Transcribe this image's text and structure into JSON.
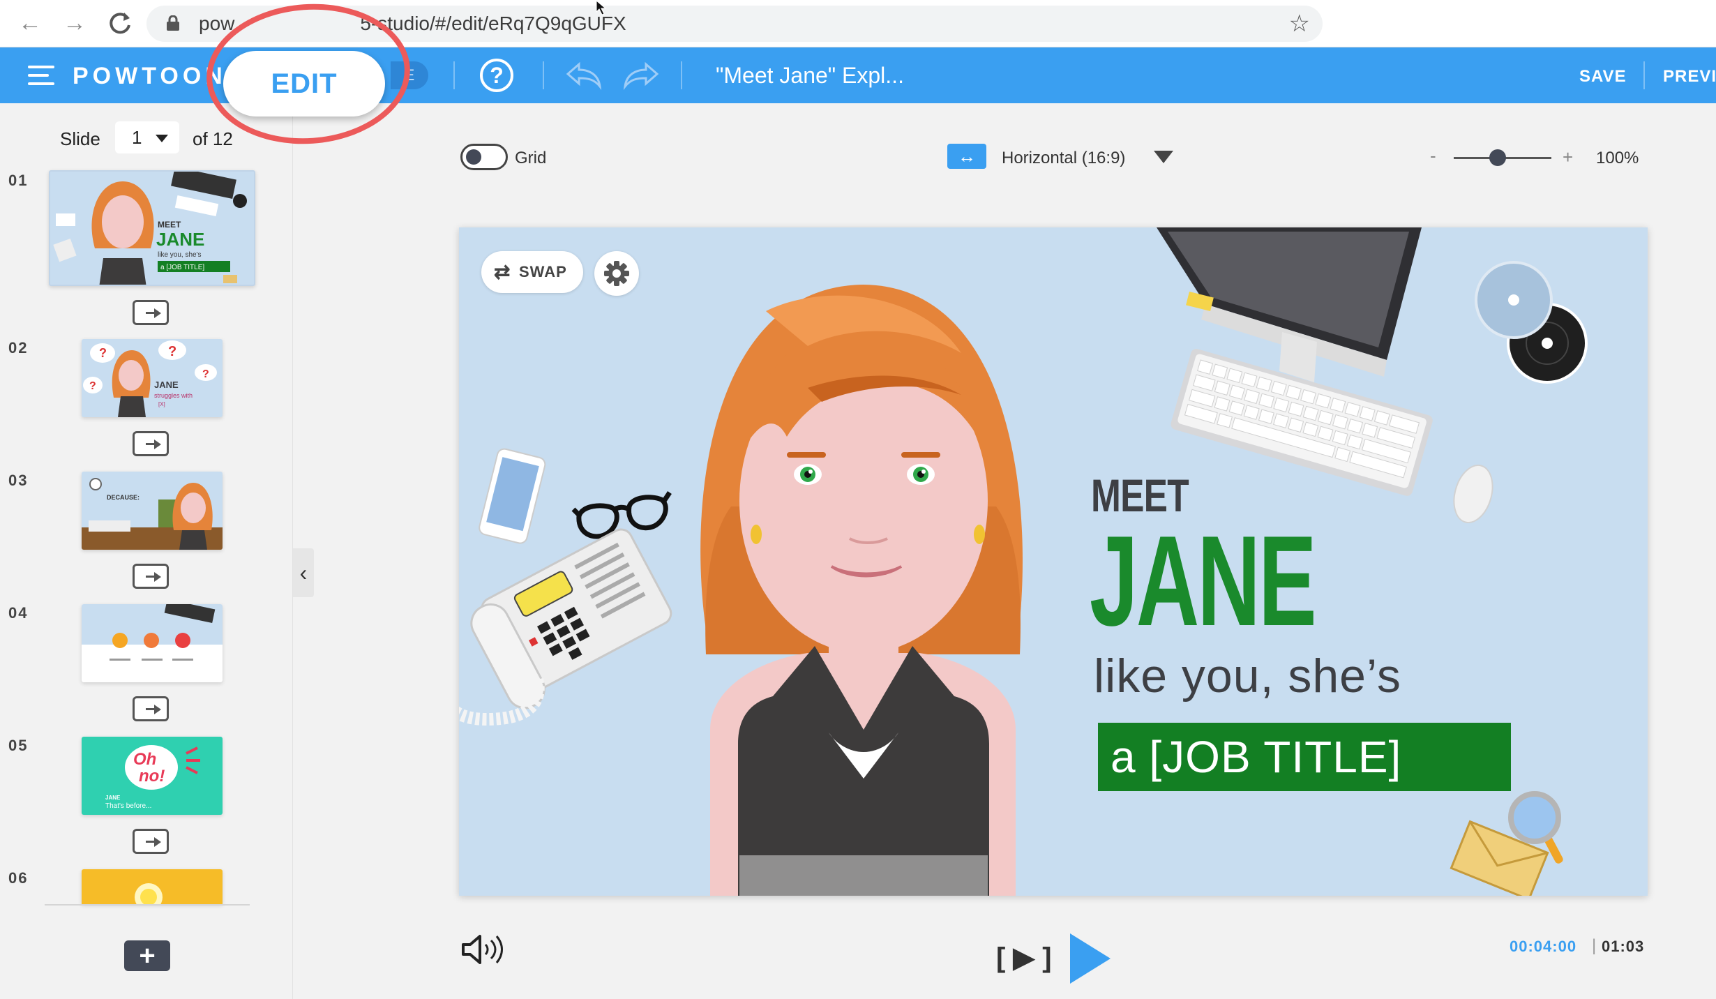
{
  "browser": {
    "url_start": "pow",
    "url_mid": "5-studio/#/edit/eRq7Q9qGUFX"
  },
  "header": {
    "logo": "POWTOON",
    "edit_label": "EDIT",
    "mode_tab_fragment": "E",
    "help_label": "?",
    "title": "\"Meet Jane\" Expl...",
    "save_label": "SAVE",
    "preview_label": "PREVI"
  },
  "sidebar": {
    "slide_label": "Slide",
    "slide_value": "1",
    "slide_of": "of 12",
    "slides": [
      {
        "num": "01"
      },
      {
        "num": "02"
      },
      {
        "num": "03"
      },
      {
        "num": "04"
      },
      {
        "num": "05"
      },
      {
        "num": "06"
      }
    ],
    "thumb1": {
      "meet": "MEET",
      "jane": "JANE",
      "like": "like you, she's",
      "job": "a [JOB TITLE]"
    },
    "thumb2": {
      "jane": "JANE",
      "struggles": "struggles with",
      "x": "[X]"
    },
    "thumb3": {
      "text": "DECAUSE:"
    },
    "thumb5": {
      "oh": "Oh",
      "no": "no!",
      "jane": "JANE",
      "sub": "That's before..."
    },
    "add_label": "+",
    "collapse_label": "‹"
  },
  "toolbar": {
    "grid_label": "Grid",
    "ratio_label": "Horizontal (16:9)",
    "zoom_minus": "-",
    "zoom_plus": "+",
    "zoom_value": "100%",
    "zoom_level": 0.45
  },
  "canvas": {
    "swap_label": "SWAP",
    "meet": "MEET",
    "jane": "JANE",
    "like": "like you, she’s",
    "job": "a [JOB TITLE]"
  },
  "player": {
    "frame_label": "[ ▶ ]",
    "time_current": "00:04:00",
    "time_sep": "|",
    "time_total": "01:03"
  },
  "colors": {
    "accent": "#3a9ff1",
    "jane_green": "#1a8a2c",
    "job_box": "#137f23",
    "canvas_bg": "#c8ddf0",
    "highlight": "#ec5a5a"
  }
}
